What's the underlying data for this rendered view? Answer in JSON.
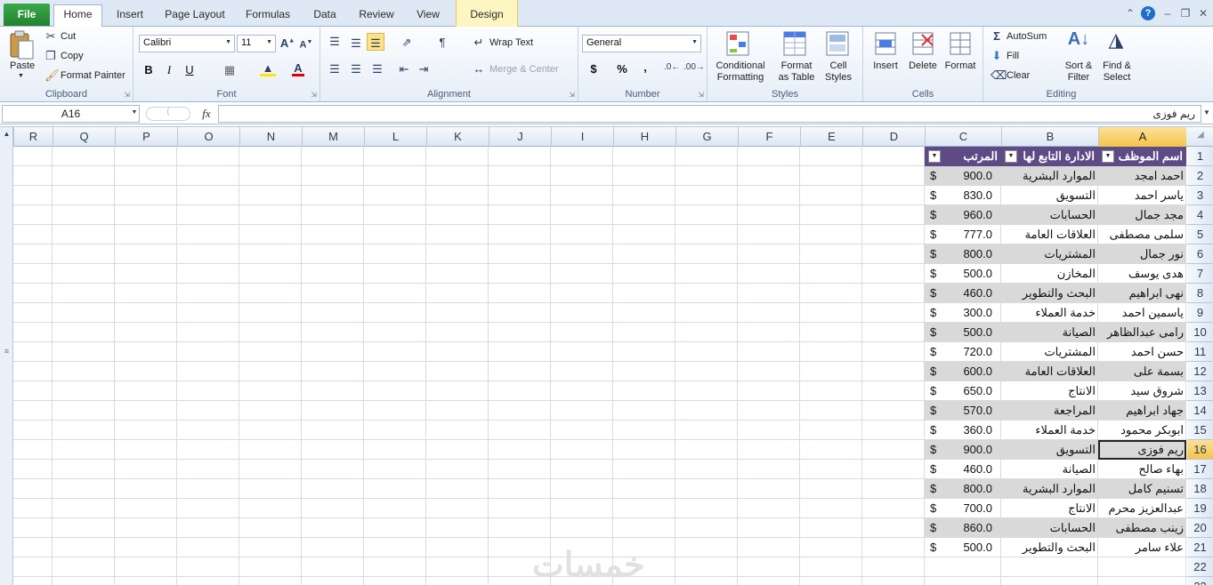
{
  "tabs": {
    "file": "File",
    "home": "Home",
    "insert": "Insert",
    "page_layout": "Page Layout",
    "formulas": "Formulas",
    "data": "Data",
    "review": "Review",
    "view": "View",
    "design": "Design"
  },
  "clipboard": {
    "paste": "Paste",
    "cut": "Cut",
    "copy": "Copy",
    "format_painter": "Format Painter",
    "group": "Clipboard"
  },
  "font": {
    "name": "Calibri",
    "size": "11",
    "bold": "B",
    "italic": "I",
    "underline": "U",
    "group": "Font"
  },
  "alignment": {
    "wrap_text": "Wrap Text",
    "merge_center": "Merge & Center",
    "group": "Alignment"
  },
  "number": {
    "format": "General",
    "currency": "$",
    "percent": "%",
    "comma": ",",
    "group": "Number"
  },
  "styles": {
    "conditional_1": "Conditional",
    "conditional_2": "Formatting",
    "format_table_1": "Format",
    "format_table_2": "as Table",
    "cell_styles_1": "Cell",
    "cell_styles_2": "Styles",
    "group": "Styles"
  },
  "cells": {
    "insert": "Insert",
    "delete": "Delete",
    "format": "Format",
    "group": "Cells"
  },
  "editing": {
    "autosum": "AutoSum",
    "fill": "Fill",
    "clear": "Clear",
    "sort_1": "Sort &",
    "sort_2": "Filter",
    "find_1": "Find &",
    "find_2": "Select",
    "group": "Editing"
  },
  "formula_bar": {
    "name_box": "A16",
    "fx": "fx",
    "content": "ريم فوزى"
  },
  "columns": [
    "R",
    "Q",
    "P",
    "O",
    "N",
    "M",
    "L",
    "K",
    "J",
    "I",
    "H",
    "G",
    "F",
    "E",
    "D",
    "C",
    "B",
    "A"
  ],
  "selected_column": "A",
  "rows": [
    "1",
    "2",
    "3",
    "4",
    "5",
    "6",
    "7",
    "8",
    "9",
    "10",
    "11",
    "12",
    "13",
    "14",
    "15",
    "16",
    "17",
    "18",
    "19",
    "20",
    "21",
    "22",
    "23"
  ],
  "selected_row": "16",
  "table": {
    "headers": {
      "name": "اسم الموظف",
      "department": "الادارة التابع لها",
      "salary": "المرتب"
    },
    "currency_symbol": "$",
    "rows": [
      {
        "name": "احمد امجد",
        "department": "الموارد البشرية",
        "salary": "900.0"
      },
      {
        "name": "ياسر احمد",
        "department": "التسويق",
        "salary": "830.0"
      },
      {
        "name": "مجد جمال",
        "department": "الحسابات",
        "salary": "960.0"
      },
      {
        "name": "سلمى مصطفى",
        "department": "العلاقات العامة",
        "salary": "777.0"
      },
      {
        "name": "نور جمال",
        "department": "المشتريات",
        "salary": "800.0"
      },
      {
        "name": "هدى يوسف",
        "department": "المخازن",
        "salary": "500.0"
      },
      {
        "name": "نهى ابراهيم",
        "department": "البحث والتطوير",
        "salary": "460.0"
      },
      {
        "name": "ياسمين احمد",
        "department": "خدمة العملاء",
        "salary": "300.0"
      },
      {
        "name": "رامى عبدالظاهر",
        "department": "الصيانة",
        "salary": "500.0"
      },
      {
        "name": "حسن احمد",
        "department": "المشتريات",
        "salary": "720.0"
      },
      {
        "name": "بسمة على",
        "department": "العلاقات العامة",
        "salary": "600.0"
      },
      {
        "name": "شروق سيد",
        "department": "الانتاج",
        "salary": "650.0"
      },
      {
        "name": "جهاد ابراهيم",
        "department": "المراجعة",
        "salary": "570.0"
      },
      {
        "name": "ابوبكر محمود",
        "department": "خدمة العملاء",
        "salary": "360.0"
      },
      {
        "name": "ريم فوزى",
        "department": "التسويق",
        "salary": "900.0"
      },
      {
        "name": "بهاء صالح",
        "department": "الصيانة",
        "salary": "460.0"
      },
      {
        "name": "تسنيم كامل",
        "department": "الموارد البشرية",
        "salary": "800.0"
      },
      {
        "name": "عبدالعزيز محرم",
        "department": "الانتاج",
        "salary": "700.0"
      },
      {
        "name": "زينب مصطفى",
        "department": "الحسابات",
        "salary": "860.0"
      },
      {
        "name": "علاء سامر",
        "department": "البحث والتطوير",
        "salary": "500.0"
      }
    ]
  },
  "watermark": "خمسات"
}
